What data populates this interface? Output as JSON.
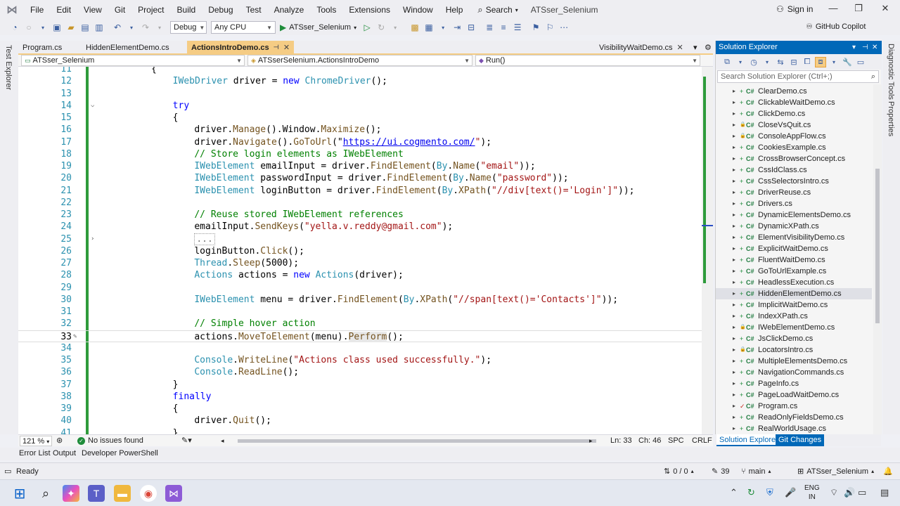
{
  "menubar": {
    "items": [
      "File",
      "Edit",
      "View",
      "Git",
      "Project",
      "Build",
      "Debug",
      "Test",
      "Analyze",
      "Tools",
      "Extensions",
      "Window",
      "Help"
    ],
    "search_label": "Search",
    "solution_title": "ATSser_Selenium",
    "signin_label": "Sign in"
  },
  "toolbar": {
    "config": "Debug",
    "platform": "Any CPU",
    "run_target": "ATSser_Selenium",
    "copilot_label": "GitHub Copilot"
  },
  "left_strip": {
    "label": "Test Explorer"
  },
  "right_strip": {
    "labels": [
      "Diagnostic Tools",
      "Properties"
    ]
  },
  "tabs": [
    {
      "label": "Program.cs"
    },
    {
      "label": "HiddenElementDemo.cs"
    },
    {
      "label": "ActionsIntroDemo.cs"
    },
    {
      "label": "VisibilityWaitDemo.cs"
    }
  ],
  "navbar": {
    "project": "ATSser_Selenium",
    "class": "ATSserSelenium.ActionsIntroDemo",
    "member": "Run()"
  },
  "code_lines": [
    {
      "n": "11",
      "segs": [
        [
          "pl",
          "{"
        ]
      ],
      "indent": 8
    },
    {
      "n": "12",
      "segs": [
        [
          "ty",
          "IWebDriver"
        ],
        [
          "pl",
          " driver = "
        ],
        [
          "kw",
          "new"
        ],
        [
          "pl",
          " "
        ],
        [
          "ty",
          "ChromeDriver"
        ],
        [
          "pl",
          "();"
        ]
      ],
      "indent": 12
    },
    {
      "n": "13",
      "segs": [],
      "indent": 12
    },
    {
      "n": "14",
      "segs": [
        [
          "kw",
          "try"
        ]
      ],
      "indent": 12
    },
    {
      "n": "15",
      "segs": [
        [
          "pl",
          "{"
        ]
      ],
      "indent": 12
    },
    {
      "n": "16",
      "segs": [
        [
          "pl",
          "driver."
        ],
        [
          "mt",
          "Manage"
        ],
        [
          "pl",
          "().Window."
        ],
        [
          "mt",
          "Maximize"
        ],
        [
          "pl",
          "();"
        ]
      ],
      "indent": 16
    },
    {
      "n": "17",
      "segs": [
        [
          "pl",
          "driver."
        ],
        [
          "mt",
          "Navigate"
        ],
        [
          "pl",
          "()."
        ],
        [
          "mt",
          "GoToUrl"
        ],
        [
          "pl",
          "(\""
        ],
        [
          "url",
          "https://ui.cogmento.com/"
        ],
        [
          "st",
          "\""
        ],
        [
          "pl",
          ");"
        ]
      ],
      "indent": 16
    },
    {
      "n": "18",
      "segs": [
        [
          "cm",
          "// Store login elements as IWebElement"
        ]
      ],
      "indent": 16
    },
    {
      "n": "19",
      "segs": [
        [
          "ty",
          "IWebElement"
        ],
        [
          "pl",
          " emailInput = driver."
        ],
        [
          "mt",
          "FindElement"
        ],
        [
          "pl",
          "("
        ],
        [
          "ty",
          "By"
        ],
        [
          "pl",
          "."
        ],
        [
          "mt",
          "Name"
        ],
        [
          "pl",
          "("
        ],
        [
          "st",
          "\"email\""
        ],
        [
          "pl",
          "));"
        ]
      ],
      "indent": 16
    },
    {
      "n": "20",
      "segs": [
        [
          "ty",
          "IWebElement"
        ],
        [
          "pl",
          " passwordInput = driver."
        ],
        [
          "mt",
          "FindElement"
        ],
        [
          "pl",
          "("
        ],
        [
          "ty",
          "By"
        ],
        [
          "pl",
          "."
        ],
        [
          "mt",
          "Name"
        ],
        [
          "pl",
          "("
        ],
        [
          "st",
          "\"password\""
        ],
        [
          "pl",
          "));"
        ]
      ],
      "indent": 16
    },
    {
      "n": "21",
      "segs": [
        [
          "ty",
          "IWebElement"
        ],
        [
          "pl",
          " loginButton = driver."
        ],
        [
          "mt",
          "FindElement"
        ],
        [
          "pl",
          "("
        ],
        [
          "ty",
          "By"
        ],
        [
          "pl",
          "."
        ],
        [
          "mt",
          "XPath"
        ],
        [
          "pl",
          "("
        ],
        [
          "st",
          "\"//div[text()='Login']\""
        ],
        [
          "pl",
          "));"
        ]
      ],
      "indent": 16
    },
    {
      "n": "22",
      "segs": [],
      "indent": 16
    },
    {
      "n": "23",
      "segs": [
        [
          "cm",
          "// Reuse stored IWebElement references"
        ]
      ],
      "indent": 16
    },
    {
      "n": "24",
      "segs": [
        [
          "pl",
          "emailInput."
        ],
        [
          "mt",
          "SendKeys"
        ],
        [
          "pl",
          "("
        ],
        [
          "st",
          "\"yella.v.reddy@gmail.com\""
        ],
        [
          "pl",
          ");"
        ]
      ],
      "indent": 16
    },
    {
      "n": "25",
      "segs": [
        [
          "collapsed",
          "..."
        ]
      ],
      "indent": 16
    },
    {
      "n": "26",
      "segs": [
        [
          "pl",
          "loginButton."
        ],
        [
          "mt",
          "Click"
        ],
        [
          "pl",
          "();"
        ]
      ],
      "indent": 16
    },
    {
      "n": "27",
      "segs": [
        [
          "ty",
          "Thread"
        ],
        [
          "pl",
          "."
        ],
        [
          "mt",
          "Sleep"
        ],
        [
          "pl",
          "(5000);"
        ]
      ],
      "indent": 16
    },
    {
      "n": "28",
      "segs": [
        [
          "ty",
          "Actions"
        ],
        [
          "pl",
          " actions = "
        ],
        [
          "kw",
          "new"
        ],
        [
          "pl",
          " "
        ],
        [
          "ty",
          "Actions"
        ],
        [
          "pl",
          "(driver);"
        ]
      ],
      "indent": 16
    },
    {
      "n": "29",
      "segs": [],
      "indent": 16
    },
    {
      "n": "30",
      "segs": [
        [
          "ty",
          "IWebElement"
        ],
        [
          "pl",
          " menu = driver."
        ],
        [
          "mt",
          "FindElement"
        ],
        [
          "pl",
          "("
        ],
        [
          "ty",
          "By"
        ],
        [
          "pl",
          "."
        ],
        [
          "mt",
          "XPath"
        ],
        [
          "pl",
          "("
        ],
        [
          "st",
          "\"//span[text()='Contacts']\""
        ],
        [
          "pl",
          "));"
        ]
      ],
      "indent": 16
    },
    {
      "n": "31",
      "segs": [],
      "indent": 16
    },
    {
      "n": "32",
      "segs": [
        [
          "cm",
          "// Simple hover action"
        ]
      ],
      "indent": 16
    },
    {
      "n": "33",
      "segs": [
        [
          "pl",
          "actions."
        ],
        [
          "mt",
          "MoveToElement"
        ],
        [
          "pl",
          "(menu)."
        ],
        [
          "perform",
          "Perform"
        ],
        [
          "pl",
          "();"
        ]
      ],
      "indent": 16
    },
    {
      "n": "34",
      "segs": [],
      "indent": 16
    },
    {
      "n": "35",
      "segs": [
        [
          "ty",
          "Console"
        ],
        [
          "pl",
          "."
        ],
        [
          "mt",
          "WriteLine"
        ],
        [
          "pl",
          "("
        ],
        [
          "st",
          "\"Actions class used successfully.\""
        ],
        [
          "pl",
          ");"
        ]
      ],
      "indent": 16
    },
    {
      "n": "36",
      "segs": [
        [
          "ty",
          "Console"
        ],
        [
          "pl",
          "."
        ],
        [
          "mt",
          "ReadLine"
        ],
        [
          "pl",
          "();"
        ]
      ],
      "indent": 16
    },
    {
      "n": "37",
      "segs": [
        [
          "pl",
          "}"
        ]
      ],
      "indent": 12
    },
    {
      "n": "38",
      "segs": [
        [
          "kw",
          "finally"
        ]
      ],
      "indent": 12
    },
    {
      "n": "39",
      "segs": [
        [
          "pl",
          "{"
        ]
      ],
      "indent": 12
    },
    {
      "n": "40",
      "segs": [
        [
          "pl",
          "driver."
        ],
        [
          "mt",
          "Quit"
        ],
        [
          "pl",
          "();"
        ]
      ],
      "indent": 16
    },
    {
      "n": "41",
      "segs": [
        [
          "pl",
          "}"
        ]
      ],
      "indent": 12
    }
  ],
  "editor_status": {
    "zoom": "121 %",
    "issues": "No issues found",
    "line": "Ln: 33",
    "col": "Ch: 46",
    "spc": "SPC",
    "crlf": "CRLF"
  },
  "solution_explorer": {
    "title": "Solution Explorer",
    "search_placeholder": "Search Solution Explorer (Ctrl+;)",
    "items": [
      {
        "name": "ClearDemo.cs",
        "status": "added"
      },
      {
        "name": "ClickableWaitDemo.cs",
        "status": "added"
      },
      {
        "name": "ClickDemo.cs",
        "status": "added"
      },
      {
        "name": "CloseVsQuit.cs",
        "status": "locked"
      },
      {
        "name": "ConsoleAppFlow.cs",
        "status": "locked"
      },
      {
        "name": "CookiesExample.cs",
        "status": "added"
      },
      {
        "name": "CrossBrowserConcept.cs",
        "status": "added"
      },
      {
        "name": "CssIdClass.cs",
        "status": "added"
      },
      {
        "name": "CssSelectorsIntro.cs",
        "status": "added"
      },
      {
        "name": "DriverReuse.cs",
        "status": "added"
      },
      {
        "name": "Drivers.cs",
        "status": "added"
      },
      {
        "name": "DynamicElementsDemo.cs",
        "status": "added"
      },
      {
        "name": "DynamicXPath.cs",
        "status": "added"
      },
      {
        "name": "ElementVisibilityDemo.cs",
        "status": "added"
      },
      {
        "name": "ExplicitWaitDemo.cs",
        "status": "added"
      },
      {
        "name": "FluentWaitDemo.cs",
        "status": "added"
      },
      {
        "name": "GoToUrlExample.cs",
        "status": "added"
      },
      {
        "name": "HeadlessExecution.cs",
        "status": "added"
      },
      {
        "name": "HiddenElementDemo.cs",
        "status": "added",
        "selected": true
      },
      {
        "name": "ImplicitWaitDemo.cs",
        "status": "added"
      },
      {
        "name": "IndexXPath.cs",
        "status": "added"
      },
      {
        "name": "IWebElementDemo.cs",
        "status": "locked"
      },
      {
        "name": "JsClickDemo.cs",
        "status": "added"
      },
      {
        "name": "LocatorsIntro.cs",
        "status": "locked"
      },
      {
        "name": "MultipleElementsDemo.cs",
        "status": "added"
      },
      {
        "name": "NavigationCommands.cs",
        "status": "added"
      },
      {
        "name": "PageInfo.cs",
        "status": "added"
      },
      {
        "name": "PageLoadWaitDemo.cs",
        "status": "added"
      },
      {
        "name": "Program.cs",
        "status": "modified"
      },
      {
        "name": "ReadOnlyFieldsDemo.cs",
        "status": "added"
      },
      {
        "name": "RealWorldUsage.cs",
        "status": "added"
      }
    ],
    "tab_active": "Solution Explorer",
    "tab_other": "Git Changes"
  },
  "bottom_tabs": [
    "Error List",
    "Output",
    "Developer PowerShell"
  ],
  "statusbar": {
    "ready": "Ready",
    "errors": "0 / 0",
    "changes": "39",
    "branch": "main",
    "repo": "ATSser_Selenium"
  },
  "taskbar": {
    "lang_top": "ENG",
    "lang_bottom": "IN"
  },
  "colors": {
    "accent_tab": "#f5cc84",
    "se_title": "#0068b8",
    "change_bar": "#2e9b3b"
  }
}
